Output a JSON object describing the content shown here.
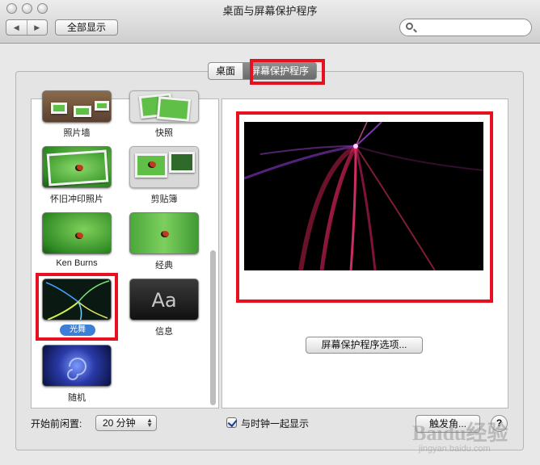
{
  "window": {
    "title": "桌面与屏幕保护程序",
    "show_all": "全部显示",
    "search_placeholder": ""
  },
  "tabs": [
    {
      "label": "桌面",
      "selected": false
    },
    {
      "label": "屏幕保护程序",
      "selected": true
    }
  ],
  "screensavers": [
    {
      "label": "照片墙",
      "selected": false
    },
    {
      "label": "快照",
      "selected": false
    },
    {
      "label": "怀旧冲印照片",
      "selected": false
    },
    {
      "label": "剪贴簿",
      "selected": false
    },
    {
      "label": "Ken Burns",
      "selected": false
    },
    {
      "label": "经典",
      "selected": false
    },
    {
      "label": "光舞",
      "selected": true
    },
    {
      "label": "信息",
      "selected": false,
      "glyph": "Aa"
    },
    {
      "label": "随机",
      "selected": false
    }
  ],
  "preview": {
    "options_button": "屏幕保护程序选项..."
  },
  "footer": {
    "start_after_label": "开始前闲置:",
    "start_after_value": "20 分钟",
    "show_with_clock_label": "与时钟一起显示",
    "show_with_clock_checked": true,
    "hot_corners_button": "触发角...",
    "help_button": "?"
  },
  "watermark": {
    "text": "Baidu经验",
    "url": "jingyan.baidu.com"
  },
  "colors": {
    "highlight_red": "#e8101f",
    "selection_blue": "#3d7fd6"
  }
}
